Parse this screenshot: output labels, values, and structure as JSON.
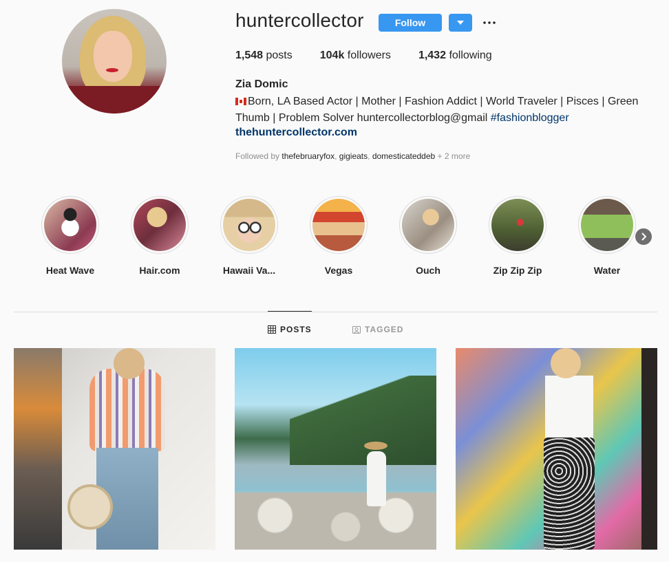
{
  "profile": {
    "username": "huntercollector",
    "follow_label": "Follow",
    "more_icon": "ellipsis-icon",
    "stats": {
      "posts_count": "1,548",
      "posts_label": "posts",
      "followers_count": "104k",
      "followers_label": "followers",
      "following_count": "1,432",
      "following_label": "following"
    },
    "full_name": "Zia Domic",
    "bio_line1": "Born, LA Based Actor | Mother | Fashion Addict | World Traveler | Pisces | Green",
    "bio_line2_text": "Thumb | Problem Solver huntercollectorblog@gmail ",
    "bio_hashtag": "#fashionblogger",
    "website": "thehuntercollector.com",
    "followed_by_prefix": "Followed by ",
    "followed_by_users": [
      "thefebruaryfox",
      "gigieats",
      "domesticateddeb"
    ],
    "followed_by_sep": ", ",
    "followed_by_suffix": " + 2 more"
  },
  "highlights": [
    {
      "label": "Heat Wave"
    },
    {
      "label": "Hair.com"
    },
    {
      "label": "Hawaii Va..."
    },
    {
      "label": "Vegas"
    },
    {
      "label": "Ouch"
    },
    {
      "label": "Zip Zip Zip"
    },
    {
      "label": "Water"
    }
  ],
  "tabs": {
    "posts": "POSTS",
    "tagged": "TAGGED"
  },
  "colors": {
    "accent": "#3897f0",
    "link": "#003569",
    "muted": "#8e8e8e",
    "text": "#262626"
  }
}
